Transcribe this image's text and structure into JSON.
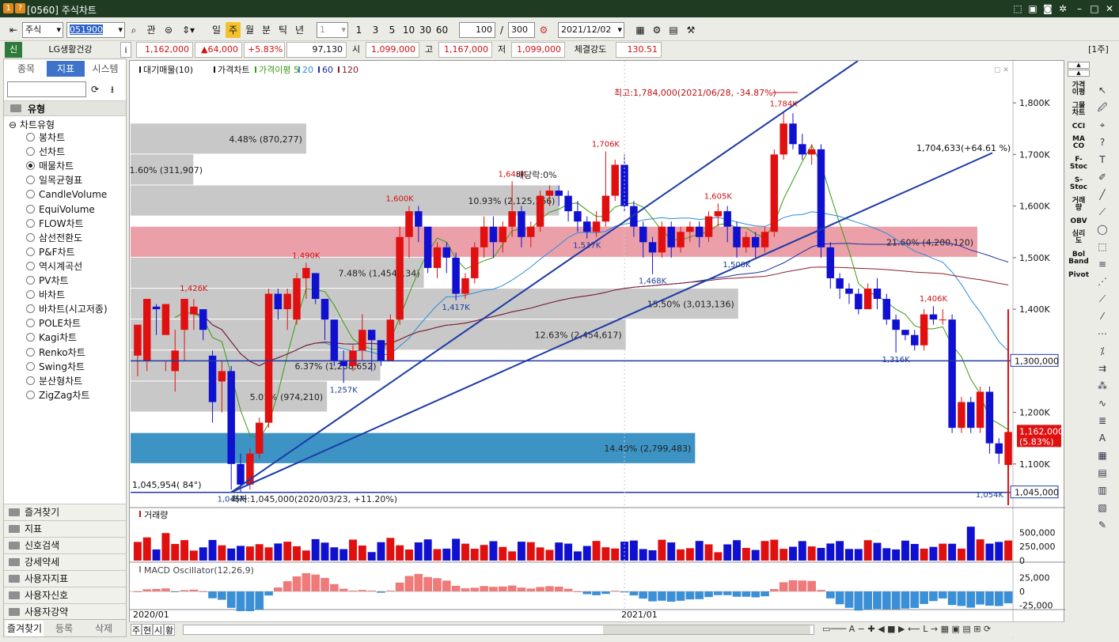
{
  "window": {
    "title": "[0560] 주식차트",
    "badge1": "1",
    "badge2": "?"
  },
  "toolbar": {
    "market": "주식",
    "code": "051900",
    "btn_kwan": "관",
    "periods": [
      "일",
      "주",
      "월",
      "분",
      "틱",
      "년"
    ],
    "active_period": "주",
    "interval_value": "1",
    "quick_intervals": [
      "1",
      "3",
      "5",
      "10",
      "30",
      "60"
    ],
    "count": "100",
    "slash": "/",
    "total": "300",
    "date": "2021/12/02"
  },
  "info": {
    "market_tag": "신",
    "name": "LG생활건강",
    "i_label": "i",
    "price": "1,162,000",
    "change": "▲64,000",
    "change_pct": "+5.83%",
    "volume": "97,130",
    "open_label": "시",
    "open": "1,099,000",
    "high_label": "고",
    "high": "1,167,000",
    "low_label": "저",
    "low": "1,099,000",
    "strength_label": "체결강도",
    "strength": "130.51",
    "period_tag": "[1주]"
  },
  "leftpanel": {
    "tabs": [
      "종목",
      "지표",
      "시스템"
    ],
    "active_tab": "지표",
    "section_title": "유형",
    "tree_root": "차트유형",
    "chart_types": [
      "봉차트",
      "선차트",
      "매물차트",
      "일목균형표",
      "CandleVolume",
      "EquiVolume",
      "FLOW차트",
      "삼선전환도",
      "P&F차트",
      "역시계곡선",
      "PV차트",
      "바차트",
      "바차트(시고저종)",
      "POLE차트",
      "Kagi차트",
      "Renko차트",
      "Swing차트",
      "분산형차트",
      "ZigZag차트"
    ],
    "selected_type": "매물차트",
    "bottom_sections": [
      "즐겨찾기",
      "지표",
      "신호검색",
      "강세약세",
      "사용자지표",
      "사용자신호",
      "사용자강약"
    ],
    "footer": [
      "즐겨찾기",
      "등록",
      "삭제"
    ]
  },
  "right_indicators": [
    "가격\n이평",
    "그물\n차트",
    "CCI",
    "MA\nCO",
    "F-\nStoc",
    "S-\nStoc",
    "거래\n량",
    "OBV",
    "심리\n도",
    "Bol\nBand",
    "Pivot"
  ],
  "bottom": {
    "tabs": [
      "주",
      "현",
      "시",
      "황"
    ]
  },
  "chart_data": {
    "type": "candlestick",
    "legend": [
      "대기매물(10)",
      "가격차트",
      "가격이평 5",
      "20",
      "60",
      "120"
    ],
    "x_ticks": [
      "2020/01",
      "2021/01"
    ],
    "y_ticks": [
      "1,800K",
      "1,700K",
      "1,600K",
      "1,500K",
      "1,400K",
      "1,300,000",
      "1,200K",
      "1,100K",
      "1,045,000"
    ],
    "price_range": [
      1020000,
      1860000
    ],
    "annotations": {
      "high_note": "최고:1,784,000(2021/06/28, -34.87%)",
      "low_note": "최저:1,045,000(2020/03/23, +11.20%)",
      "trend_label": "1,704,633(+64.61 %)",
      "hline_label": "1,300,000",
      "low_line_label": "1,045,000",
      "current_label": "1,162,000",
      "current_pct": "(5.83%)",
      "left_low_label": "1,045,954( 84°)",
      "dividend_label": "배당락:0%"
    },
    "peak_labels": [
      {
        "text": "1,426K",
        "price": 1426000,
        "i": 6
      },
      {
        "text": "1,490K",
        "price": 1490000,
        "i": 18
      },
      {
        "text": "1,600K",
        "price": 1600000,
        "i": 28
      },
      {
        "text": "1,648K",
        "price": 1648000,
        "i": 40
      },
      {
        "text": "1,706K",
        "price": 1706000,
        "i": 50
      },
      {
        "text": "1,605K",
        "price": 1605000,
        "i": 62
      },
      {
        "text": "1,784K",
        "price": 1784000,
        "i": 69
      },
      {
        "text": "1,406K",
        "price": 1406000,
        "i": 85
      },
      {
        "text": "1,045K",
        "price": 1045000,
        "i": 10
      },
      {
        "text": "1,257K",
        "price": 1257000,
        "i": 22
      },
      {
        "text": "1,417K",
        "price": 1417000,
        "i": 34
      },
      {
        "text": "1,537K",
        "price": 1537000,
        "i": 48
      },
      {
        "text": "1,468K",
        "price": 1468000,
        "i": 55
      },
      {
        "text": "1,500K",
        "price": 1500000,
        "i": 64
      },
      {
        "text": "1,316K",
        "price": 1316000,
        "i": 81
      },
      {
        "text": "1,054K",
        "price": 1054000,
        "i": 91
      }
    ],
    "volume_profile": [
      {
        "label": "4.48% (870,277)",
        "pct": 4.48,
        "lo": 1700000,
        "hi": 1760000
      },
      {
        "label": "1.60% (311,907)",
        "pct": 1.6,
        "lo": 1640000,
        "hi": 1700000
      },
      {
        "label": "10.93% (2,125,166)",
        "pct": 10.93,
        "lo": 1580000,
        "hi": 1640000
      },
      {
        "label": "21.60% (4,200,120)",
        "pct": 21.6,
        "lo": 1500000,
        "hi": 1560000
      },
      {
        "label": "7.48% (1,454,134)",
        "pct": 7.48,
        "lo": 1440000,
        "hi": 1500000
      },
      {
        "label": "15.50% (3,013,136)",
        "pct": 15.5,
        "lo": 1380000,
        "hi": 1440000
      },
      {
        "label": "12.63% (2,454,617)",
        "pct": 12.63,
        "lo": 1320000,
        "hi": 1380000
      },
      {
        "label": "6.37% (1,238,652)",
        "pct": 6.37,
        "lo": 1260000,
        "hi": 1320000
      },
      {
        "label": "5.01% (974,210)",
        "pct": 5.01,
        "lo": 1200000,
        "hi": 1260000
      },
      {
        "label": "14.40% (2,799,483)",
        "pct": 14.4,
        "lo": 1100000,
        "hi": 1160000
      }
    ],
    "candles": [
      [
        1310000,
        1370000,
        1330000,
        1270000
      ],
      [
        1300000,
        1420000,
        1410000,
        1280000
      ],
      [
        1405000,
        1400000,
        1410000,
        1350000
      ],
      [
        1350000,
        1410000,
        1300000,
        1280000
      ],
      [
        1280000,
        1320000,
        1360000,
        1240000
      ],
      [
        1360000,
        1420000,
        1390000,
        1300000
      ],
      [
        1390000,
        1405000,
        1420000,
        1360000
      ],
      [
        1400000,
        1360000,
        1400000,
        1340000
      ],
      [
        1310000,
        1220000,
        1320000,
        1180000
      ],
      [
        1260000,
        1280000,
        1300000,
        1200000
      ],
      [
        1280000,
        1100000,
        1290000,
        1050000
      ],
      [
        1100000,
        1060000,
        1120000,
        1045000
      ],
      [
        1060000,
        1120000,
        1130000,
        1050000
      ],
      [
        1120000,
        1180000,
        1190000,
        1110000
      ],
      [
        1180000,
        1430000,
        1440000,
        1170000
      ],
      [
        1430000,
        1400000,
        1440000,
        1380000
      ],
      [
        1400000,
        1430000,
        1440000,
        1360000
      ],
      [
        1380000,
        1460000,
        1470000,
        1370000
      ],
      [
        1460000,
        1480000,
        1490000,
        1420000
      ],
      [
        1470000,
        1420000,
        1470000,
        1410000
      ],
      [
        1420000,
        1380000,
        1420000,
        1340000
      ],
      [
        1380000,
        1300000,
        1380000,
        1290000
      ],
      [
        1300000,
        1290000,
        1320000,
        1257000
      ],
      [
        1290000,
        1320000,
        1330000,
        1280000
      ],
      [
        1320000,
        1360000,
        1390000,
        1300000
      ],
      [
        1360000,
        1340000,
        1360000,
        1280000
      ],
      [
        1340000,
        1300000,
        1340000,
        1290000
      ],
      [
        1300000,
        1380000,
        1390000,
        1300000
      ],
      [
        1380000,
        1540000,
        1560000,
        1370000
      ],
      [
        1540000,
        1590000,
        1600000,
        1500000
      ],
      [
        1590000,
        1560000,
        1600000,
        1530000
      ],
      [
        1560000,
        1480000,
        1560000,
        1470000
      ],
      [
        1480000,
        1520000,
        1530000,
        1460000
      ],
      [
        1520000,
        1500000,
        1530000,
        1470000
      ],
      [
        1500000,
        1430000,
        1510000,
        1417000
      ],
      [
        1430000,
        1460000,
        1470000,
        1420000
      ],
      [
        1460000,
        1520000,
        1530000,
        1450000
      ],
      [
        1520000,
        1560000,
        1580000,
        1500000
      ],
      [
        1560000,
        1530000,
        1580000,
        1500000
      ],
      [
        1530000,
        1560000,
        1570000,
        1510000
      ],
      [
        1560000,
        1590000,
        1648000,
        1540000
      ],
      [
        1590000,
        1540000,
        1600000,
        1520000
      ],
      [
        1540000,
        1560000,
        1570000,
        1520000
      ],
      [
        1560000,
        1620000,
        1630000,
        1550000
      ],
      [
        1620000,
        1630000,
        1640000,
        1600000
      ],
      [
        1630000,
        1620000,
        1640000,
        1600000
      ],
      [
        1620000,
        1590000,
        1630000,
        1570000
      ],
      [
        1590000,
        1570000,
        1610000,
        1550000
      ],
      [
        1570000,
        1550000,
        1580000,
        1537000
      ],
      [
        1550000,
        1570000,
        1590000,
        1540000
      ],
      [
        1570000,
        1620000,
        1706000,
        1560000
      ],
      [
        1620000,
        1680000,
        1690000,
        1610000
      ],
      [
        1680000,
        1600000,
        1700000,
        1590000
      ],
      [
        1600000,
        1560000,
        1610000,
        1540000
      ],
      [
        1560000,
        1530000,
        1570000,
        1500000
      ],
      [
        1530000,
        1510000,
        1540000,
        1468000
      ],
      [
        1510000,
        1560000,
        1570000,
        1500000
      ],
      [
        1560000,
        1520000,
        1570000,
        1500000
      ],
      [
        1520000,
        1550000,
        1560000,
        1510000
      ],
      [
        1550000,
        1560000,
        1570000,
        1530000
      ],
      [
        1560000,
        1540000,
        1570000,
        1520000
      ],
      [
        1540000,
        1580000,
        1590000,
        1530000
      ],
      [
        1580000,
        1590000,
        1605000,
        1560000
      ],
      [
        1590000,
        1560000,
        1600000,
        1530000
      ],
      [
        1560000,
        1520000,
        1570000,
        1500000
      ],
      [
        1520000,
        1540000,
        1550000,
        1510000
      ],
      [
        1540000,
        1520000,
        1550000,
        1500000
      ],
      [
        1520000,
        1550000,
        1560000,
        1510000
      ],
      [
        1550000,
        1700000,
        1710000,
        1540000
      ],
      [
        1700000,
        1760000,
        1784000,
        1690000
      ],
      [
        1760000,
        1720000,
        1780000,
        1710000
      ],
      [
        1720000,
        1700000,
        1740000,
        1690000
      ],
      [
        1700000,
        1710000,
        1720000,
        1680000
      ],
      [
        1710000,
        1520000,
        1720000,
        1500000
      ],
      [
        1520000,
        1460000,
        1530000,
        1440000
      ],
      [
        1460000,
        1440000,
        1470000,
        1420000
      ],
      [
        1440000,
        1430000,
        1450000,
        1410000
      ],
      [
        1430000,
        1400000,
        1440000,
        1390000
      ],
      [
        1400000,
        1440000,
        1450000,
        1400000
      ],
      [
        1440000,
        1420000,
        1460000,
        1400000
      ],
      [
        1420000,
        1380000,
        1430000,
        1370000
      ],
      [
        1380000,
        1360000,
        1390000,
        1316000
      ],
      [
        1360000,
        1350000,
        1360000,
        1340000
      ],
      [
        1350000,
        1330000,
        1360000,
        1320000
      ],
      [
        1330000,
        1390000,
        1400000,
        1320000
      ],
      [
        1390000,
        1380000,
        1406000,
        1370000
      ],
      [
        1380000,
        1380000,
        1400000,
        1370000
      ],
      [
        1380000,
        1170000,
        1390000,
        1160000
      ],
      [
        1170000,
        1220000,
        1230000,
        1160000
      ],
      [
        1220000,
        1170000,
        1230000,
        1160000
      ],
      [
        1170000,
        1240000,
        1250000,
        1160000
      ],
      [
        1240000,
        1140000,
        1250000,
        1120000
      ],
      [
        1140000,
        1120000,
        1150000,
        1100000
      ],
      [
        1098000,
        1162000,
        1167000,
        1054000
      ]
    ],
    "volume_panel": {
      "title": "거래량",
      "ticks": [
        "500,000",
        "250,000",
        "0"
      ],
      "max": 700000
    },
    "macd_panel": {
      "title": "MACD Oscillator(12,26,9)",
      "ticks": [
        "25,000",
        "0",
        "-25,000"
      ],
      "range": [
        -40000,
        40000
      ]
    }
  }
}
